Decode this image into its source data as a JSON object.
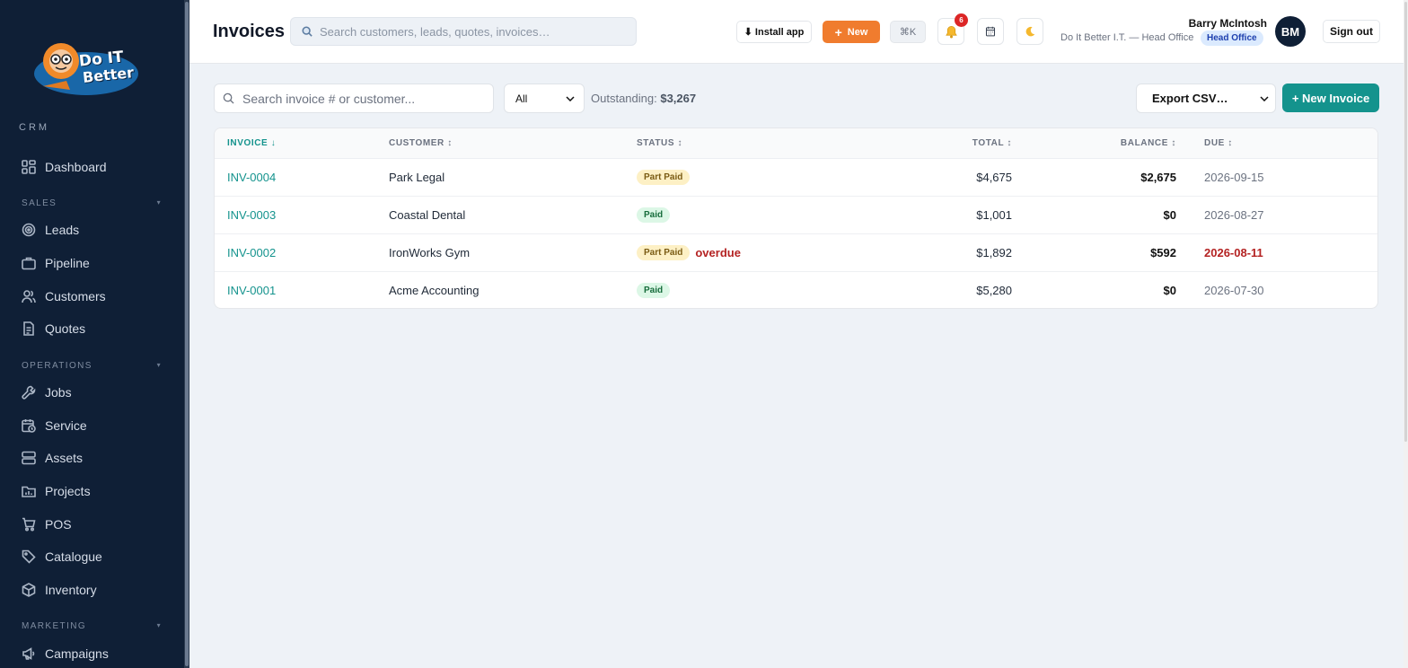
{
  "sidebar": {
    "logo_text_top": "Do IT",
    "logo_text_bottom": "Better",
    "crm_label": "CRM",
    "items": [
      {
        "label": "Dashboard",
        "icon": "grid-icon"
      },
      {
        "label": "Leads",
        "icon": "target-icon"
      },
      {
        "label": "Pipeline",
        "icon": "briefcase-icon"
      },
      {
        "label": "Customers",
        "icon": "users-icon"
      },
      {
        "label": "Quotes",
        "icon": "document-icon"
      },
      {
        "label": "Jobs",
        "icon": "wrench-icon"
      },
      {
        "label": "Service",
        "icon": "calendar-clock-icon"
      },
      {
        "label": "Assets",
        "icon": "server-icon"
      },
      {
        "label": "Projects",
        "icon": "folder-chart-icon"
      },
      {
        "label": "POS",
        "icon": "cart-icon"
      },
      {
        "label": "Catalogue",
        "icon": "tag-icon"
      },
      {
        "label": "Inventory",
        "icon": "box-icon"
      },
      {
        "label": "Campaigns",
        "icon": "megaphone-icon"
      }
    ],
    "sections": {
      "sales": "SALES",
      "operations": "OPERATIONS",
      "marketing": "MARKETING"
    }
  },
  "header": {
    "title": "Invoices",
    "search_placeholder": "Search customers, leads, quotes, invoices…",
    "install_label": "⬇ Install app",
    "new_label": "New",
    "kbd_label": "⌘K",
    "notification_count": "6",
    "user_name": "Barry McIntosh",
    "user_org": "Do It Better I.T. — Head Office",
    "office_badge": "Head Office",
    "avatar_initials": "BM",
    "signout_label": "Sign out"
  },
  "toolbar": {
    "search_placeholder": "Search invoice # or customer...",
    "status_filter": "All",
    "outstanding_label": "Outstanding:",
    "outstanding_value": "$3,267",
    "export_label": "Export CSV…",
    "new_invoice_label": "+ New Invoice"
  },
  "table": {
    "columns": {
      "invoice": "INVOICE ↓",
      "customer": "CUSTOMER ↕",
      "status": "STATUS ↕",
      "total": "TOTAL ↕",
      "balance": "BALANCE ↕",
      "due": "DUE ↕"
    },
    "rows": [
      {
        "invoice": "INV-0004",
        "customer": "Park Legal",
        "status": "Part Paid",
        "overdue": "",
        "total": "$4,675",
        "balance": "$2,675",
        "due": "2026-09-15"
      },
      {
        "invoice": "INV-0003",
        "customer": "Coastal Dental",
        "status": "Paid",
        "overdue": "",
        "total": "$1,001",
        "balance": "$0",
        "due": "2026-08-27"
      },
      {
        "invoice": "INV-0002",
        "customer": "IronWorks Gym",
        "status": "Part Paid",
        "overdue": "overdue",
        "total": "$1,892",
        "balance": "$592",
        "due": "2026-08-11"
      },
      {
        "invoice": "INV-0001",
        "customer": "Acme Accounting",
        "status": "Paid",
        "overdue": "",
        "total": "$5,280",
        "balance": "$0",
        "due": "2026-07-30"
      }
    ]
  },
  "colors": {
    "sidebar_bg": "#0f1f36",
    "accent": "#14938d",
    "new_button": "#f07c2e",
    "overdue": "#b42323"
  }
}
